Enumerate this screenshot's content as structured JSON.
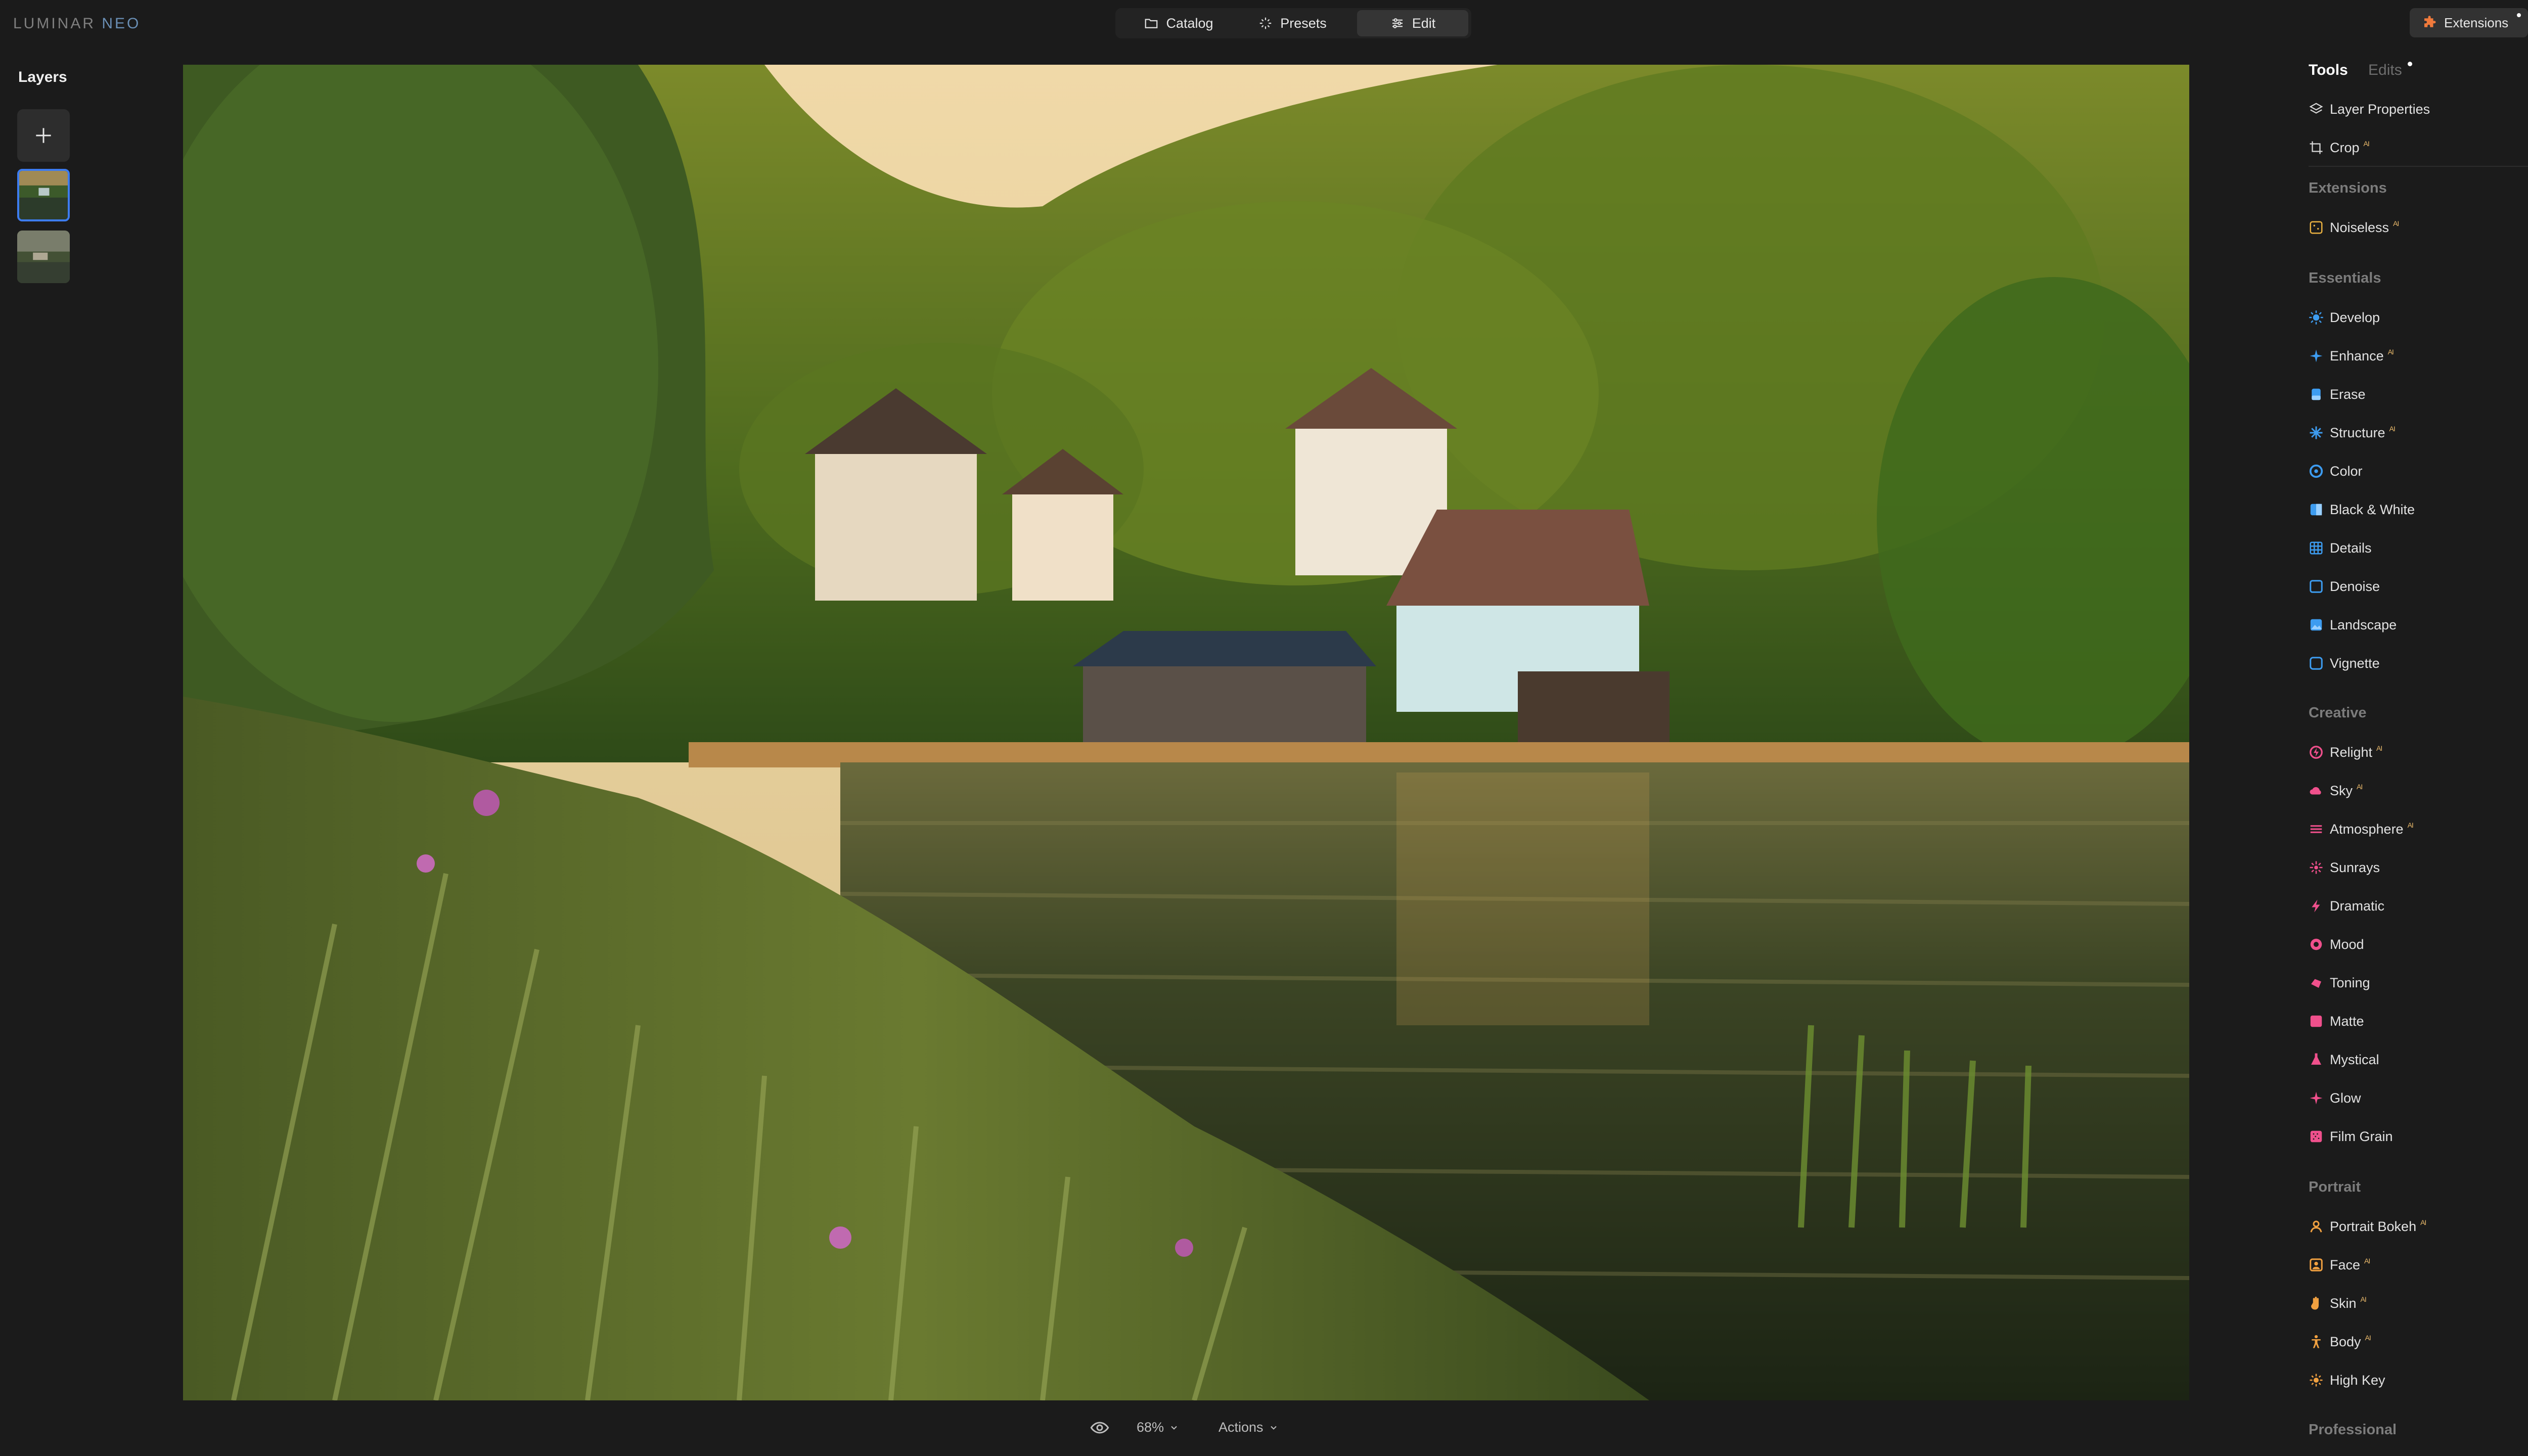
{
  "app": {
    "logo_main": "LUMINAR",
    "logo_accent": "NEO"
  },
  "nav": {
    "catalog": "Catalog",
    "presets": "Presets",
    "edit": "Edit",
    "active": "edit"
  },
  "extensions_button": "Extensions",
  "layers": {
    "title": "Layers"
  },
  "bottom": {
    "zoom": "68%",
    "actions": "Actions"
  },
  "tabs": {
    "tools": "Tools",
    "edits": "Edits"
  },
  "ai_mark": "AI",
  "colors": {
    "accent_blue": "#3d7cf0",
    "creative_pink": "#f0508c",
    "portrait_orange": "#f0a040",
    "ai_badge": "#e8b86a"
  },
  "tools": {
    "layer_properties": "Layer Properties",
    "crop": "Crop",
    "sections": {
      "extensions": "Extensions",
      "essentials": "Essentials",
      "creative": "Creative",
      "portrait": "Portrait",
      "professional": "Professional"
    },
    "extensions": [
      "Noiseless"
    ],
    "essentials": [
      "Develop",
      "Enhance",
      "Erase",
      "Structure",
      "Color",
      "Black & White",
      "Details",
      "Denoise",
      "Landscape",
      "Vignette"
    ],
    "creative": [
      "Relight",
      "Sky",
      "Atmosphere",
      "Sunrays",
      "Dramatic",
      "Mood",
      "Toning",
      "Matte",
      "Mystical",
      "Glow",
      "Film Grain"
    ],
    "portrait": [
      "Portrait Bokeh",
      "Face",
      "Skin",
      "Body",
      "High Key"
    ]
  }
}
